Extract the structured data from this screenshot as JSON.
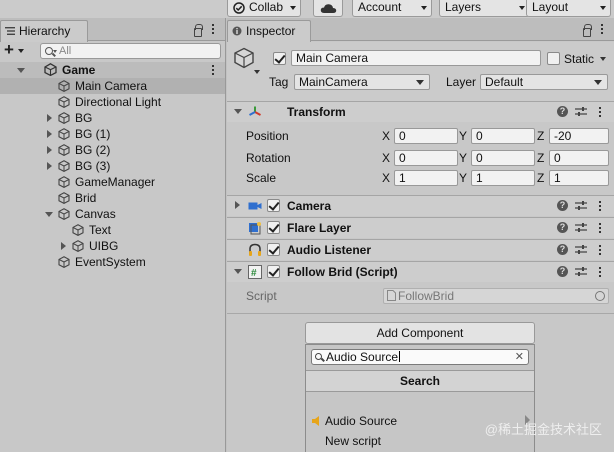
{
  "toolbar": {
    "collab": "Collab",
    "account": "Account",
    "layers": "Layers",
    "layout": "Layout"
  },
  "hierarchy": {
    "tab_label": "Hierarchy",
    "search_placeholder": "All",
    "scene": "Game",
    "items": [
      {
        "label": "Main Camera",
        "depth": 1,
        "expander": "none",
        "selected": true
      },
      {
        "label": "Directional Light",
        "depth": 1,
        "expander": "none"
      },
      {
        "label": "BG",
        "depth": 1,
        "expander": "collapsed"
      },
      {
        "label": "BG (1)",
        "depth": 1,
        "expander": "collapsed"
      },
      {
        "label": "BG (2)",
        "depth": 1,
        "expander": "collapsed"
      },
      {
        "label": "BG (3)",
        "depth": 1,
        "expander": "collapsed"
      },
      {
        "label": "GameManager",
        "depth": 1,
        "expander": "none"
      },
      {
        "label": "Brid",
        "depth": 1,
        "expander": "none"
      },
      {
        "label": "Canvas",
        "depth": 1,
        "expander": "expanded"
      },
      {
        "label": "Text",
        "depth": 2,
        "expander": "none"
      },
      {
        "label": "UIBG",
        "depth": 2,
        "expander": "collapsed"
      },
      {
        "label": "EventSystem",
        "depth": 1,
        "expander": "none"
      }
    ]
  },
  "inspector": {
    "tab_label": "Inspector",
    "object_name": "Main Camera",
    "static_label": "Static",
    "tag_label": "Tag",
    "tag_value": "MainCamera",
    "layer_label": "Layer",
    "layer_value": "Default",
    "transform": {
      "title": "Transform",
      "position_label": "Position",
      "rotation_label": "Rotation",
      "scale_label": "Scale",
      "x": "X",
      "y": "Y",
      "z": "Z",
      "position": [
        "0",
        "0",
        "-20"
      ],
      "rotation": [
        "0",
        "0",
        "0"
      ],
      "scale": [
        "1",
        "1",
        "1"
      ]
    },
    "components": [
      {
        "title": "Camera",
        "icon": "camera-icon"
      },
      {
        "title": "Flare Layer",
        "icon": "flare-layer-icon"
      },
      {
        "title": "Audio Listener",
        "icon": "audio-listener-icon"
      },
      {
        "title": "Follow Brid (Script)",
        "icon": "script-icon"
      }
    ],
    "script_label": "Script",
    "script_value": "FollowBrid",
    "add_component": "Add Component",
    "popup": {
      "search_value": "Audio Source",
      "title": "Search",
      "results": [
        "Audio Source",
        "New script"
      ]
    }
  },
  "watermark": "@稀土掘金技术社区",
  "colors": {
    "panel_bg": "#c8c8c8",
    "selection": "#b1b1b1",
    "camera_icon": "#2f6fcf",
    "transform_red": "#d23a2a",
    "speaker_yellow": "#e7a51a",
    "script_green": "#2c8a3c"
  }
}
